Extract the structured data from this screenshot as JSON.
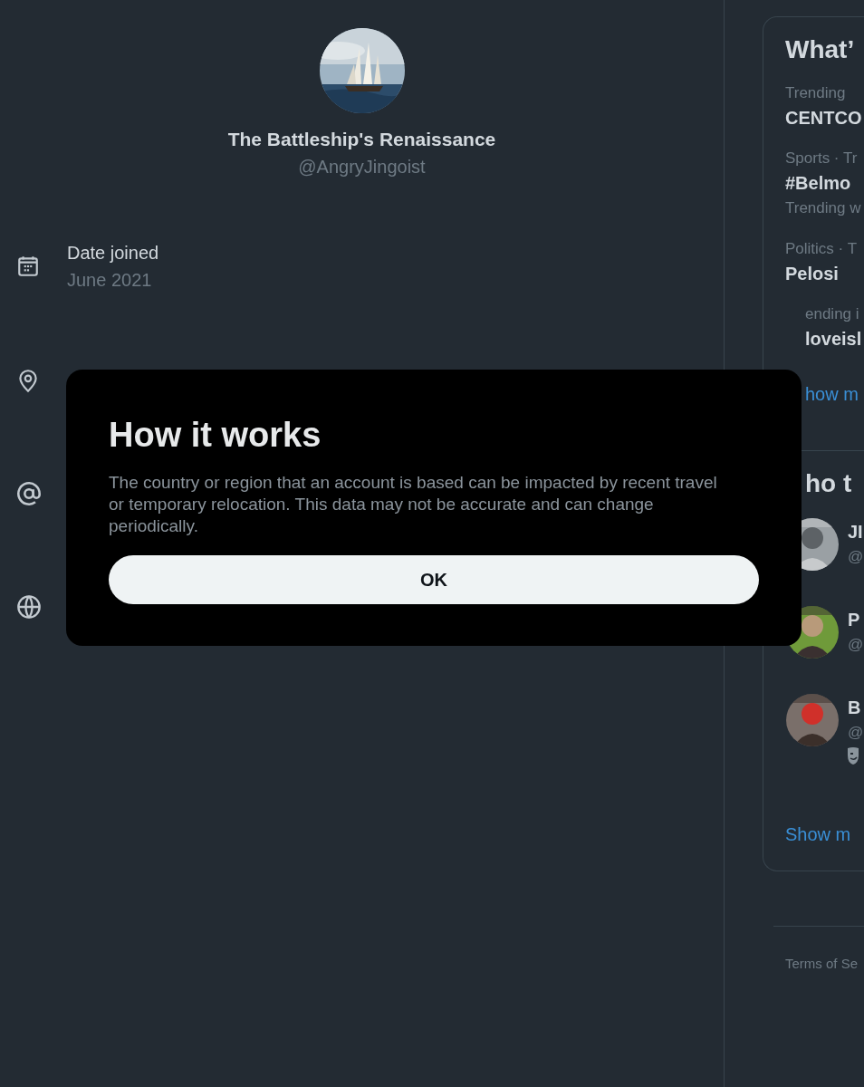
{
  "profile": {
    "name": "The Battleship's Renaissance",
    "handle": "@AngryJingoist"
  },
  "details": [
    {
      "kind": "calendar",
      "label": "Date joined",
      "value": "June 2021"
    },
    {
      "kind": "location"
    },
    {
      "kind": "at"
    },
    {
      "kind": "globe"
    }
  ],
  "sidebar": {
    "trends_title": {
      "text": "What’",
      "covered": false
    },
    "trends": [
      {
        "meta": "Trending",
        "topic": "CENTCO",
        "covered": false
      },
      {
        "meta": "Sports · Tr",
        "topic": "#Belmo",
        "posts": "Trending w",
        "covered": false
      },
      {
        "meta": "Politics · T",
        "topic": "Pelosi",
        "covered": false
      },
      {
        "meta": "ending i",
        "topic": "loveisl",
        "covered": true
      }
    ],
    "trends_more": {
      "text": "how m",
      "covered": true
    },
    "who_title": {
      "text": "ho t",
      "covered": true
    },
    "accounts": [
      {
        "name": "JI",
        "handle": "@",
        "badge": false
      },
      {
        "name": "P",
        "handle": "@",
        "badge": false
      },
      {
        "name": "B",
        "handle": "@",
        "badge": true
      }
    ],
    "who_more": {
      "text": "Show m",
      "covered": false
    },
    "footer": "Terms of Se"
  },
  "dialog": {
    "title": "How it works",
    "body": "The country or region that an account is based can be impacted by recent travel or temporary relocation. This data may not be accurate and can change periodically.",
    "button": "OK"
  }
}
